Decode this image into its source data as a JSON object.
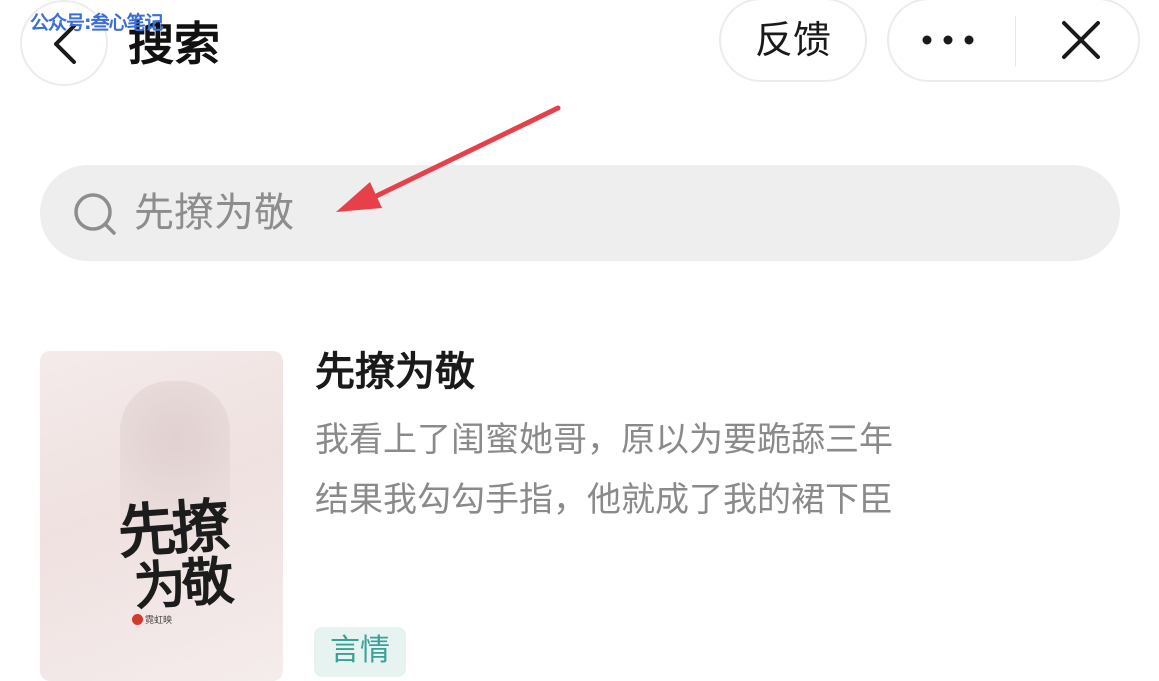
{
  "watermark": "公众号:叁心笔记",
  "header": {
    "title": "搜索",
    "feedback_label": "反馈"
  },
  "search": {
    "query": "先撩为敬"
  },
  "result": {
    "title": "先撩为敬",
    "description_lines": [
      "我看上了闺蜜她哥，原以为要跪舔三年",
      "结果我勾勾手指，他就成了我的裙下臣"
    ],
    "genre_tag": "言情",
    "cover": {
      "title_line1": "先撩",
      "title_line2": "为敬",
      "author_mark": "霓虹映"
    }
  },
  "icons": {
    "back": "chevron-left-icon",
    "more": "ellipsis-icon",
    "close": "close-icon",
    "search": "search-icon"
  },
  "colors": {
    "annotation_arrow": "#e8404a",
    "tag_text": "#3aa196",
    "tag_bg": "#e6f3f1",
    "search_bg": "#eeeeee"
  }
}
